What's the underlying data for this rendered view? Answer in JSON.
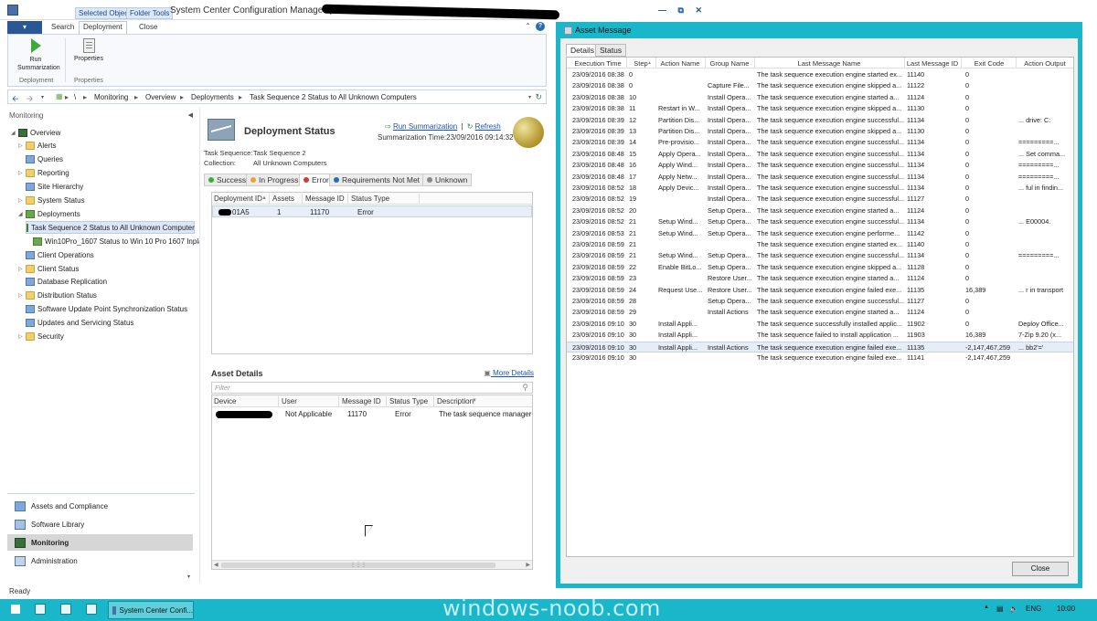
{
  "window": {
    "contextual_tabs": [
      "Selected Object",
      "Folder Tools"
    ],
    "title": "System Center Configuration Manager (Co"
  },
  "ribbon": {
    "file_label": "",
    "tabs": [
      "Search",
      "Deployment",
      "Close"
    ],
    "run_summarization": "Run Summarization",
    "properties": "Properties",
    "group_deployment": "Deployment",
    "group_properties": "Properties"
  },
  "address": {
    "root": "\\",
    "crumbs": [
      "Monitoring",
      "Overview",
      "Deployments",
      "Task Sequence 2 Status to All Unknown Computers"
    ]
  },
  "nav": {
    "title": "Monitoring",
    "tree": [
      {
        "label": "Overview",
        "icon": "overview-icon",
        "indent": 0,
        "expander": "◢"
      },
      {
        "label": "Alerts",
        "icon": "folder-icon",
        "indent": 1,
        "expander": "▷"
      },
      {
        "label": "Queries",
        "icon": "queries-icon",
        "indent": 1,
        "expander": ""
      },
      {
        "label": "Reporting",
        "icon": "folder-icon",
        "indent": 1,
        "expander": "▷"
      },
      {
        "label": "Site Hierarchy",
        "icon": "hierarchy-icon",
        "indent": 1,
        "expander": ""
      },
      {
        "label": "System Status",
        "icon": "folder-icon",
        "indent": 1,
        "expander": "▷"
      },
      {
        "label": "Deployments",
        "icon": "deployments-icon",
        "indent": 1,
        "expander": "◢"
      },
      {
        "label": "Task Sequence 2 Status to All Unknown Computer",
        "icon": "deployment-icon",
        "indent": 2,
        "expander": "",
        "selected": true
      },
      {
        "label": "Win10Pro_1607 Status to Win 10 Pro 1607 Inplace",
        "icon": "deployment-icon",
        "indent": 2,
        "expander": ""
      },
      {
        "label": "Client Operations",
        "icon": "client-ops-icon",
        "indent": 1,
        "expander": ""
      },
      {
        "label": "Client Status",
        "icon": "folder-icon",
        "indent": 1,
        "expander": "▷"
      },
      {
        "label": "Database Replication",
        "icon": "database-icon",
        "indent": 1,
        "expander": ""
      },
      {
        "label": "Distribution Status",
        "icon": "folder-icon",
        "indent": 1,
        "expander": "▷"
      },
      {
        "label": "Software Update Point Synchronization Status",
        "icon": "sync-icon",
        "indent": 1,
        "expander": ""
      },
      {
        "label": "Updates and Servicing Status",
        "icon": "updates-icon",
        "indent": 1,
        "expander": ""
      },
      {
        "label": "Security",
        "icon": "folder-icon",
        "indent": 1,
        "expander": "▷"
      }
    ],
    "workspaces": [
      "Assets and Compliance",
      "Software Library",
      "Monitoring",
      "Administration"
    ]
  },
  "deployment_status": {
    "title": "Deployment Status",
    "run_summarization_link": "Run Summarization",
    "refresh_link": "Refresh",
    "summarization_time": "Summarization Time:23/09/2016 09:14:32",
    "task_sequence_label": "Task Sequence:",
    "task_sequence_value": "Task Sequence 2",
    "collection_label": "Collection:",
    "collection_value": "All Unknown Computers",
    "tabs": [
      {
        "label": "Success",
        "color": "#3caa3c"
      },
      {
        "label": "In Progress",
        "color": "#e8a33a"
      },
      {
        "label": "Error",
        "color": "#d23b2f"
      },
      {
        "label": "Requirements Not Met",
        "color": "#2b6cb0"
      },
      {
        "label": "Unknown",
        "color": "#888888"
      }
    ],
    "summary_columns": [
      "Deployment ID",
      "Assets",
      "Message ID",
      "Status Type"
    ],
    "summary_rows": [
      {
        "deployment_id": "01A5",
        "assets": "1",
        "message_id": "11170",
        "status_type": "Error"
      }
    ],
    "asset_details_title": "Asset Details",
    "more_details": "More Details",
    "filter_placeholder": "Filter",
    "asset_columns": [
      "Device",
      "User",
      "Message ID",
      "Status Type",
      "Description"
    ],
    "asset_rows": [
      {
        "device": "",
        "user": "Not Applicable",
        "message_id": "11170",
        "status_type": "Error",
        "description": "The task sequence manager cou"
      }
    ]
  },
  "status_bar": "Ready",
  "dialog": {
    "title": "Asset Message",
    "tabs": [
      "Details",
      "Status"
    ],
    "columns": [
      "Execution Time",
      "Step",
      "Action Name",
      "Group Name",
      "Last Message Name",
      "Last Message ID",
      "Exit Code",
      "Action Output"
    ],
    "rows": [
      [
        "23/09/2016 08:38",
        "0",
        "",
        "",
        "The task sequence execution engine started ex...",
        "11140",
        "0",
        ""
      ],
      [
        "23/09/2016 08:38",
        "0",
        "",
        "Capture File...",
        "The task sequence execution engine skipped a...",
        "11122",
        "0",
        ""
      ],
      [
        "23/09/2016 08:38",
        "10",
        "",
        "Install Opera...",
        "The task sequence execution engine started a...",
        "11124",
        "0",
        ""
      ],
      [
        "23/09/2016 08:38",
        "11",
        "Restart in W...",
        "Install Opera...",
        "The task sequence execution engine skipped a...",
        "11130",
        "0",
        ""
      ],
      [
        "23/09/2016 08:39",
        "12",
        "Partition Dis...",
        "Install Opera...",
        "The task sequence execution engine successful...",
        "11134",
        "0",
        "... drive: C:"
      ],
      [
        "23/09/2016 08:39",
        "13",
        "Partition Dis...",
        "Install Opera...",
        "The task sequence execution engine skipped a...",
        "11130",
        "0",
        ""
      ],
      [
        "23/09/2016 08:39",
        "14",
        "Pre-provisio...",
        "Install Opera...",
        "The task sequence execution engine successful...",
        "11134",
        "0",
        "=========..."
      ],
      [
        "23/09/2016 08:48",
        "15",
        "Apply Opera...",
        "Install Opera...",
        "The task sequence execution engine successful...",
        "11134",
        "0",
        "... Set comma..."
      ],
      [
        "23/09/2016 08:48",
        "16",
        "Apply Wind...",
        "Install Opera...",
        "The task sequence execution engine successful...",
        "11134",
        "0",
        "=========..."
      ],
      [
        "23/09/2016 08:48",
        "17",
        "Apply Netw...",
        "Install Opera...",
        "The task sequence execution engine successful...",
        "11134",
        "0",
        "=========..."
      ],
      [
        "23/09/2016 08:52",
        "18",
        "Apply Devic...",
        "Install Opera...",
        "The task sequence execution engine successful...",
        "11134",
        "0",
        "... ful in findin..."
      ],
      [
        "23/09/2016 08:52",
        "19",
        "",
        "Install Opera...",
        "The task sequence execution engine successful...",
        "11127",
        "0",
        ""
      ],
      [
        "23/09/2016 08:52",
        "20",
        "",
        "Setup Opera...",
        "The task sequence execution engine started a...",
        "11124",
        "0",
        ""
      ],
      [
        "23/09/2016 08:52",
        "21",
        "Setup Wind...",
        "Setup Opera...",
        "The task sequence execution engine successful...",
        "11134",
        "0",
        "... E00004."
      ],
      [
        "23/09/2016 08:53",
        "21",
        "Setup Wind...",
        "Setup Opera...",
        "The task sequence execution engine performe...",
        "11142",
        "0",
        ""
      ],
      [
        "23/09/2016 08:59",
        "21",
        "",
        "",
        "The task sequence execution engine started ex...",
        "11140",
        "0",
        ""
      ],
      [
        "23/09/2016 08:59",
        "21",
        "Setup Wind...",
        "Setup Opera...",
        "The task sequence execution engine successful...",
        "11134",
        "0",
        "=========..."
      ],
      [
        "23/09/2016 08:59",
        "22",
        "Enable BitLo...",
        "Setup Opera...",
        "The task sequence execution engine skipped a...",
        "11128",
        "0",
        ""
      ],
      [
        "23/09/2016 08:59",
        "23",
        "",
        "Restore User...",
        "The task sequence execution engine started a...",
        "11124",
        "0",
        ""
      ],
      [
        "23/09/2016 08:59",
        "24",
        "Request Use...",
        "Restore User...",
        "The task sequence execution engine failed exe...",
        "11135",
        "16,389",
        "... r in transport"
      ],
      [
        "23/09/2016 08:59",
        "28",
        "",
        "Setup Opera...",
        "The task sequence execution engine successful...",
        "11127",
        "0",
        ""
      ],
      [
        "23/09/2016 08:59",
        "29",
        "",
        "Install Actions",
        "The task sequence execution engine started a...",
        "11124",
        "0",
        ""
      ],
      [
        "23/09/2016 09:10",
        "30",
        "Install Appli...",
        "",
        "The task sequence successfully installed applic...",
        "11902",
        "0",
        "Deploy Office..."
      ],
      [
        "23/09/2016 09:10",
        "30",
        "Install Appli...",
        "",
        "The task sequence failed to install application ...",
        "11903",
        "16,389",
        "7-Zip 9.20 (x..."
      ],
      [
        "23/09/2016 09:10",
        "30",
        "Install Appli...",
        "Install Actions",
        "The task sequence execution engine failed exe...",
        "11135",
        "-2,147,467,259",
        "... bb2'='"
      ],
      [
        "23/09/2016 09:10",
        "30",
        "",
        "",
        "The task sequence execution engine failed exe...",
        "11141",
        "-2,147,467,259",
        ""
      ]
    ],
    "selected_row": 24,
    "close_label": "Close"
  },
  "taskbar": {
    "app_label": "System Center Confi...",
    "language": "ENG",
    "time": "10:00",
    "watermark": "windows-noob.com"
  }
}
